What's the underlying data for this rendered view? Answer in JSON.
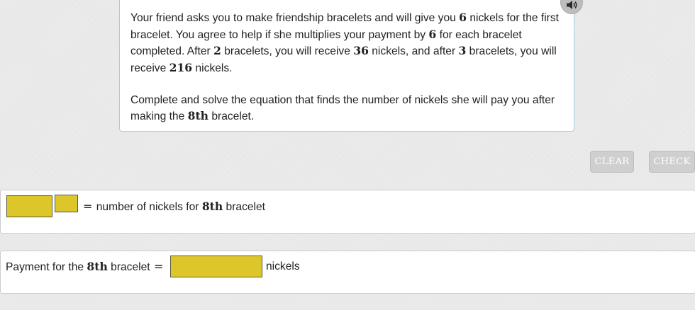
{
  "question": {
    "p1": {
      "t1": "Your friend asks you to make friendship bracelets and will give you ",
      "n1": "6",
      "t2": " nickels for the first bracelet. You agree to help if she multiplies your payment by ",
      "n2": "6",
      "t3": " for each bracelet completed. After ",
      "n3": "2",
      "t4": " bracelets, you will receive ",
      "n4": "36",
      "t5": " nickels, and after ",
      "n5": "3",
      "t6": " bracelets, you will receive ",
      "n6": "216",
      "t7": " nickels."
    },
    "p2": {
      "t1": "Complete and solve the equation that finds the number of nickels she will pay you after making the ",
      "n1": "8th",
      "t2": " bracelet."
    }
  },
  "audio": {
    "icon": "speaker-icon"
  },
  "buttons": {
    "clear": "CLEAR",
    "check": "CHECK"
  },
  "row1": {
    "base_value": "",
    "exponent_value": "",
    "equals": "=",
    "text_before": " number of nickels for ",
    "ordinal": "8th",
    "text_after": " bracelet"
  },
  "row2": {
    "text_before": "Payment for the ",
    "ordinal": "8th",
    "text_mid": " bracelet ",
    "equals": "=",
    "payment_value": "",
    "unit": "nickels"
  },
  "colors": {
    "answer_box": "#dcc62a",
    "card_border": "#9fd2dc",
    "button_bg": "#cfcfcf"
  }
}
